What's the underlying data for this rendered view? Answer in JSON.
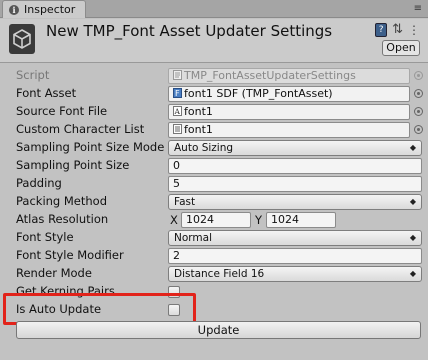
{
  "window": {
    "tab_label": "Inspector",
    "title": "New TMP_Font Asset Updater Settings",
    "open_button": "Open"
  },
  "fields": {
    "script": {
      "label": "Script",
      "value": "TMP_FontAssetUpdaterSettings"
    },
    "font_asset": {
      "label": "Font Asset",
      "value": "font1 SDF (TMP_FontAsset)"
    },
    "source_font_file": {
      "label": "Source Font File",
      "value": "font1"
    },
    "custom_character_list": {
      "label": "Custom Character List",
      "value": "font1"
    },
    "sampling_point_size_mode": {
      "label": "Sampling Point Size Mode",
      "value": "Auto Sizing"
    },
    "sampling_point_size": {
      "label": "Sampling Point Size",
      "value": "0"
    },
    "padding": {
      "label": "Padding",
      "value": "5"
    },
    "packing_method": {
      "label": "Packing Method",
      "value": "Fast"
    },
    "atlas_resolution": {
      "label": "Atlas Resolution",
      "x_label": "X",
      "x_value": "1024",
      "y_label": "Y",
      "y_value": "1024"
    },
    "font_style": {
      "label": "Font Style",
      "value": "Normal"
    },
    "font_style_modifier": {
      "label": "Font Style Modifier",
      "value": "2"
    },
    "render_mode": {
      "label": "Render Mode",
      "value": "Distance Field 16"
    },
    "get_kerning_pairs": {
      "label": "Get Kerning Pairs",
      "checked": false
    },
    "is_auto_update": {
      "label": "Is Auto Update",
      "checked": false
    }
  },
  "update_button": "Update",
  "colors": {
    "highlight": "#e2231a",
    "panel": "#c2c2c2"
  }
}
